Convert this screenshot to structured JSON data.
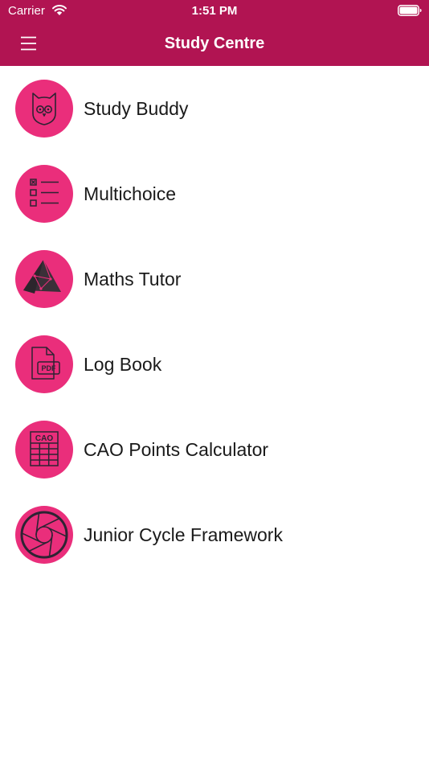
{
  "status_bar": {
    "carrier": "Carrier",
    "time": "1:51 PM",
    "wifi_icon": "wifi-icon",
    "battery_icon": "battery-icon"
  },
  "nav": {
    "title": "Study Centre",
    "menu_icon": "hamburger-menu-icon"
  },
  "colors": {
    "header_background": "#b11452",
    "icon_circle": "#ea2e7b",
    "icon_stroke": "#2d2333",
    "label_text": "#1a1a1a",
    "background": "#ffffff"
  },
  "items": [
    {
      "label": "Study Buddy",
      "icon": "owl-icon"
    },
    {
      "label": "Multichoice",
      "icon": "checklist-icon"
    },
    {
      "label": "Maths Tutor",
      "icon": "pyramid-icon"
    },
    {
      "label": "Log Book",
      "icon": "pdf-document-icon",
      "icon_text": "PDF"
    },
    {
      "label": "CAO Points Calculator",
      "icon": "cao-grid-icon",
      "icon_text": "CAO"
    },
    {
      "label": "Junior Cycle Framework",
      "icon": "aperture-icon"
    }
  ]
}
